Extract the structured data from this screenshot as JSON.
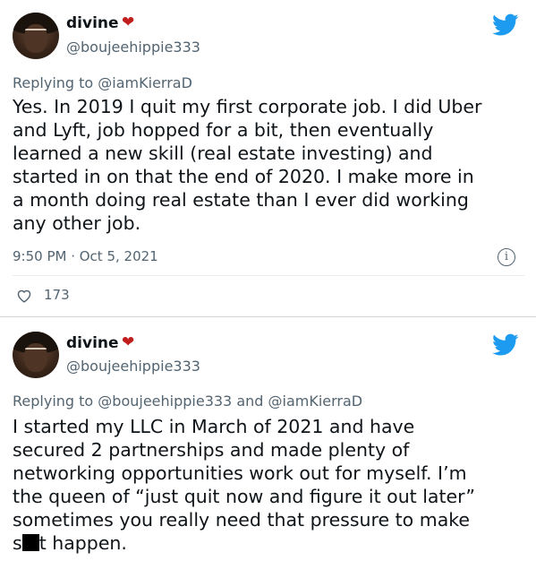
{
  "tweets": [
    {
      "display_name": "divine",
      "heart_emoji": "❤",
      "handle": "@boujeehippie333",
      "replying_to": "Replying to @iamKierraD",
      "text": "Yes. In 2019 I quit my first corporate job. I did Uber\nand Lyft, job hopped for a bit, then eventually\nlearned a new skill (real estate investing) and\nstarted in on that the end of 2020. I make more in\na month doing real estate than I ever did working\nany other job.",
      "timestamp": "9:50 PM · Oct 5, 2021",
      "likes": "173",
      "icons": {
        "avatar": "profile-photo",
        "bird": "twitter-bird-icon",
        "info": "info-icon",
        "like": "heart-outline-icon"
      }
    },
    {
      "display_name": "divine",
      "heart_emoji": "❤",
      "handle": "@boujeehippie333",
      "replying_to": "Replying to @boujeehippie333 and @iamKierraD",
      "text_before_redaction": "I started my LLC in March of 2021 and have\nsecured 2 partnerships and made plenty of\nnetworking opportunities work out for myself. I’m\nthe queen of “just quit now and figure it out later”\nsometimes you really need that pressure to make\ns",
      "text_after_redaction": "t happen."
    }
  ],
  "colors": {
    "heart": "#c21d1d",
    "twitter_blue": "#1d9bf0",
    "muted_text": "#536471"
  }
}
